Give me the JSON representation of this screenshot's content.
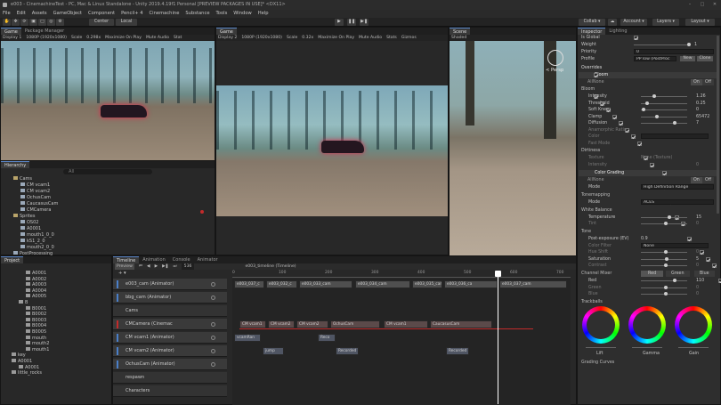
{
  "window": {
    "title": "e003 - CinemachineTest - PC, Mac & Linux Standalone - Unity 2019.4.19f1 Personal [PREVIEW PACKAGES IN USE]* <DX11>"
  },
  "menu": [
    "File",
    "Edit",
    "Assets",
    "GameObject",
    "Component",
    "Pencil+ 4",
    "Cinemachine",
    "Substance",
    "Tools",
    "Window",
    "Help"
  ],
  "toolbar": {
    "center": "Center",
    "local": "Local",
    "collab": "Collab ▾",
    "account": "Account ▾",
    "layers": "Layers ▾",
    "layout": "Layout ▾"
  },
  "game_left": {
    "tabs": [
      "Game",
      "Package Manager"
    ],
    "display": "Display 1",
    "resolution": "1080P (1920x1080)",
    "scale_label": "Scale",
    "scale_value": "0.298x",
    "maximize": "Maximize On Play",
    "mute": "Mute Audio",
    "stats": "Stat"
  },
  "game_center": {
    "tab": "Game",
    "display": "Display 2",
    "resolution": "1080P (1920x1080)",
    "scale_label": "Scale",
    "scale_value": "0.32x",
    "maximize": "Maximize On Play",
    "mute": "Mute Audio",
    "stats": "Stats",
    "gizmos": "Gizmos"
  },
  "scene_view": {
    "tab": "Scene",
    "shading": "Shaded",
    "persp": "< Persp"
  },
  "hierarchy": {
    "tab": "Hierarchy",
    "search_placeholder": "All",
    "items": [
      {
        "label": "Cams",
        "indent": 1,
        "icon": "folder"
      },
      {
        "label": "CM vcam1",
        "indent": 2,
        "icon": "camera"
      },
      {
        "label": "CM vcam2",
        "indent": 2,
        "icon": "camera"
      },
      {
        "label": "OchusCam",
        "indent": 2,
        "icon": "camera"
      },
      {
        "label": "CaucasusCam",
        "indent": 2,
        "icon": "camera"
      },
      {
        "label": "CMCamera",
        "indent": 2,
        "icon": "camera"
      },
      {
        "label": "Sprites",
        "indent": 1,
        "icon": "folder"
      },
      {
        "label": "OS02",
        "indent": 2,
        "icon": "obj"
      },
      {
        "label": "A0001",
        "indent": 2,
        "icon": "obj"
      },
      {
        "label": "mouth1_0_0",
        "indent": 2,
        "icon": "obj"
      },
      {
        "label": "kS1_2_0",
        "indent": 2,
        "icon": "obj"
      },
      {
        "label": "mouth2_0_0",
        "indent": 2,
        "icon": "obj"
      },
      {
        "label": "PostProcessing",
        "indent": 1,
        "icon": "obj"
      }
    ]
  },
  "project": {
    "tab": "Project",
    "items": [
      {
        "label": "A0001",
        "indent": 3
      },
      {
        "label": "A0002",
        "indent": 3
      },
      {
        "label": "A0003",
        "indent": 3
      },
      {
        "label": "A0004",
        "indent": 3
      },
      {
        "label": "A0005",
        "indent": 3
      },
      {
        "label": "B",
        "indent": 2
      },
      {
        "label": "B0001",
        "indent": 3
      },
      {
        "label": "B0002",
        "indent": 3
      },
      {
        "label": "B0003",
        "indent": 3
      },
      {
        "label": "B0004",
        "indent": 3
      },
      {
        "label": "B0005",
        "indent": 3
      },
      {
        "label": "mouth",
        "indent": 3
      },
      {
        "label": "mouth2",
        "indent": 3
      },
      {
        "label": "mouth1",
        "indent": 3
      },
      {
        "label": "key",
        "indent": 1
      },
      {
        "label": "A0001",
        "indent": 1
      },
      {
        "label": "A0001",
        "indent": 2
      },
      {
        "label": "little_rocks",
        "indent": 1
      }
    ]
  },
  "timeline": {
    "tabs": [
      "Timeline",
      "Animation",
      "Console",
      "Animator"
    ],
    "preview": "Preview",
    "frame": "536",
    "asset": "e003_timeline (Timeline)",
    "ruler": [
      "0",
      "100",
      "200",
      "300",
      "400",
      "500",
      "600",
      "700"
    ],
    "tracks": [
      {
        "label": "e003_cam (Animator)",
        "kind": "anim"
      },
      {
        "label": "bbg_cam (Animator)",
        "kind": "anim"
      },
      {
        "label": "Cams",
        "kind": "group"
      },
      {
        "label": "CMCamera (Cinemac",
        "kind": "cine"
      },
      {
        "label": "CM vcam1 (Animator)",
        "kind": "anim"
      },
      {
        "label": "CM vcam2 (Animator)",
        "kind": "anim"
      },
      {
        "label": "OchusCam (Animator)",
        "kind": "anim"
      },
      {
        "label": "respawn",
        "kind": "group"
      },
      {
        "label": "Characters",
        "kind": "group"
      }
    ],
    "clips_row0": [
      "e003_037_c",
      "e003_032_c",
      "e003_033_cam",
      "e003_034_cam",
      "e003_035_cam",
      "e003_036_ca",
      "e003_037_cam"
    ],
    "clips_cine": [
      "CM vcam1",
      "CM vcam2",
      "CM vcam2",
      "OchusCam",
      "CM vcam1",
      "CaucasusCam"
    ],
    "clips_vcam1": [
      "vcamRan",
      "Reco"
    ],
    "clips_vcam2": [
      "jump",
      "Recorded",
      "Recorded"
    ]
  },
  "inspector": {
    "tabs": [
      "Inspector",
      "Lighting"
    ],
    "is_global": "Is Global",
    "weight": "Weight",
    "weight_val": "1",
    "priority": "Priority",
    "priority_val": "0",
    "profile": "Profile",
    "profile_val": "PP low (PostProc",
    "new": "New",
    "clone": "Clone",
    "overrides": "Overrides",
    "bloom": "Bloom",
    "all": "All",
    "none": "None",
    "on": "On",
    "off": "Off",
    "bloom_section": "Bloom",
    "bloom_rows": [
      {
        "k": "Intensity",
        "v": "1.26"
      },
      {
        "k": "Threshold",
        "v": "0.25"
      },
      {
        "k": "Soft Knee",
        "v": "0"
      },
      {
        "k": "Clamp",
        "v": "65472"
      },
      {
        "k": "Diffusion",
        "v": "7"
      },
      {
        "k": "Anamorphic Ratio",
        "v": "0"
      },
      {
        "k": "Color",
        "v": ""
      },
      {
        "k": "Fast Mode",
        "v": ""
      }
    ],
    "dirtiness": "Dirtiness",
    "texture": "Texture",
    "texture_val": "None (Texture)",
    "intensity2": "Intensity",
    "intensity2_val": "0",
    "color_grading": "Color Grading",
    "mode": "Mode",
    "mode_val": "High Definition Range",
    "tonemapping": "Tonemapping",
    "tm_mode": "Mode",
    "tm_mode_val": "ACES",
    "white_balance": "White Balance",
    "temperature": "Temperature",
    "temperature_val": "15",
    "tint": "Tint",
    "tint_val": "0",
    "tone": "Tone",
    "post_exposure": "Post-exposure (EV)",
    "post_exposure_val": "0.9",
    "color_filter": "Color Filter",
    "hue_shift": "Hue Shift",
    "hue_shift_val": "0",
    "saturation": "Saturation",
    "saturation_val": "5",
    "contrast": "Contrast",
    "contrast_val": "0",
    "channel_mixer": "Channel Mixer",
    "cm_red": "Red",
    "cm_green": "Green",
    "cm_blue": "Blue",
    "red": "Red",
    "red_val": "110",
    "green": "Green",
    "green_val": "0",
    "blue": "Blue",
    "blue_val": "0",
    "trackballs": "Trackballs",
    "lift": "Lift",
    "gamma": "Gamma",
    "gain": "Gain",
    "grading_curves": "Grading Curves"
  },
  "colors": {
    "accent": "#4a7fc9",
    "record": "#c22b2b",
    "playhead": "#ffffff"
  }
}
